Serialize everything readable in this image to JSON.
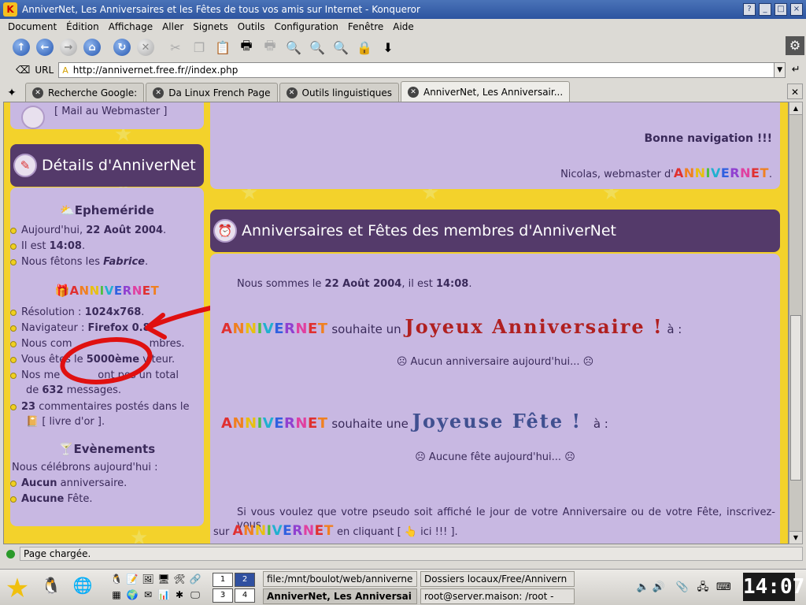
{
  "window": {
    "title": "AnniverNet, Les Anniversaires et les Fêtes de tous vos amis sur Internet - Konqueror"
  },
  "menu": [
    "Document",
    "Édition",
    "Affichage",
    "Aller",
    "Signets",
    "Outils",
    "Configuration",
    "Fenêtre",
    "Aide"
  ],
  "toolbar_icons": [
    "up-arrow",
    "back-arrow",
    "forward-arrow",
    "home",
    "reload",
    "stop",
    "cut",
    "copy",
    "paste",
    "print",
    "print-frame",
    "zoom-in",
    "zoom-in-small",
    "zoom-out",
    "lock",
    "download"
  ],
  "url": {
    "label": "URL",
    "value": "http://annivernet.free.fr//index.php"
  },
  "tabs": [
    {
      "label": "Recherche Google:",
      "active": false
    },
    {
      "label": "Da Linux French Page",
      "active": false
    },
    {
      "label": "Outils linguistiques",
      "active": false
    },
    {
      "label": "AnniverNet, Les Anniversair...",
      "active": true
    }
  ],
  "page": {
    "webmaster_link": "[ Mail au Webmaster ]",
    "details_header": "Détails d'AnniverNet",
    "ephemeride": {
      "title": "Epheméride",
      "date_prefix": "Aujourd'hui, ",
      "date": "22 Août 2004",
      "date_suffix": ".",
      "time_prefix": "Il est ",
      "time": "14:08",
      "time_suffix": ".",
      "fete_prefix": "Nous fêtons les ",
      "fete": "Fabrice",
      "fete_suffix": "."
    },
    "annivernet_logo": "ANNIVERNET",
    "stats": {
      "resolution_prefix": "Résolution : ",
      "resolution": "1024x768",
      "resolution_suffix": ".",
      "browser_prefix": "Navigateur : ",
      "browser": "Firefox 0.8",
      "members_a": "Nous com",
      "members_b": "mbres.",
      "visitor_prefix": "Vous ê",
      "visitor_mid": "tes le ",
      "visitor": "5000ème",
      "visitor_suffix": " vi",
      "visitor_end": "teur.",
      "messages_a": "Nos me",
      "messages_b": "ont pos",
      "messages_c": "un total",
      "messages_prefix": "de ",
      "messages": "632",
      "messages_suffix": " messages.",
      "comments": "23",
      "comments_line": " commentaires postés dans le",
      "guestbook": "[ livre d'or ]."
    },
    "events": {
      "title": "Evènements",
      "intro": "Nous célébrons aujourd'hui :",
      "anniv_bold": "Aucun",
      "anniv_rest": " anniversaire.",
      "fete_bold": "Aucune",
      "fete_rest": " Fête."
    },
    "welcome": {
      "bonne": "Bonne navigation !!!",
      "sign_prefix": "Nicolas, webmaster d'",
      "sign_suffix": "."
    },
    "main_header": "Anniversaires et Fêtes des membres d'AnniverNet",
    "today_prefix": "Nous sommes le ",
    "today_date": "22 Août 2004",
    "today_mid": ", il est ",
    "today_time": "14:08",
    "today_suffix": ".",
    "wish_birthday": "souhaite un",
    "joyeux": "Joyeux Anniversaire !",
    "colon": "à :",
    "no_birthday": "Aucun anniversaire aujourd'hui...",
    "wish_fete": "souhaite une",
    "joyeuse": "Joyeuse Fête !",
    "no_fete": "Aucune fête aujourd'hui...",
    "pseudo_text": "Si vous voulez que votre pseudo soit affiché le jour de votre Anniversaire ou de votre Fête, inscrivez-vous",
    "sur": "sur ",
    "cliquant": " en cliquant [ ",
    "ici": "ici !!! ]."
  },
  "status": "Page chargée.",
  "taskbar": {
    "pager": [
      "1",
      "2",
      "3",
      "4"
    ],
    "tasks": [
      {
        "label": "file:/mnt/boulot/web/anniverne",
        "active": false
      },
      {
        "label": "Dossiers locaux/Free/Annivern",
        "active": false
      },
      {
        "label": "AnniverNet, Les Anniversai",
        "active": true
      },
      {
        "label": "root@server.maison: /root -",
        "active": false
      }
    ],
    "clock": "14:07"
  }
}
